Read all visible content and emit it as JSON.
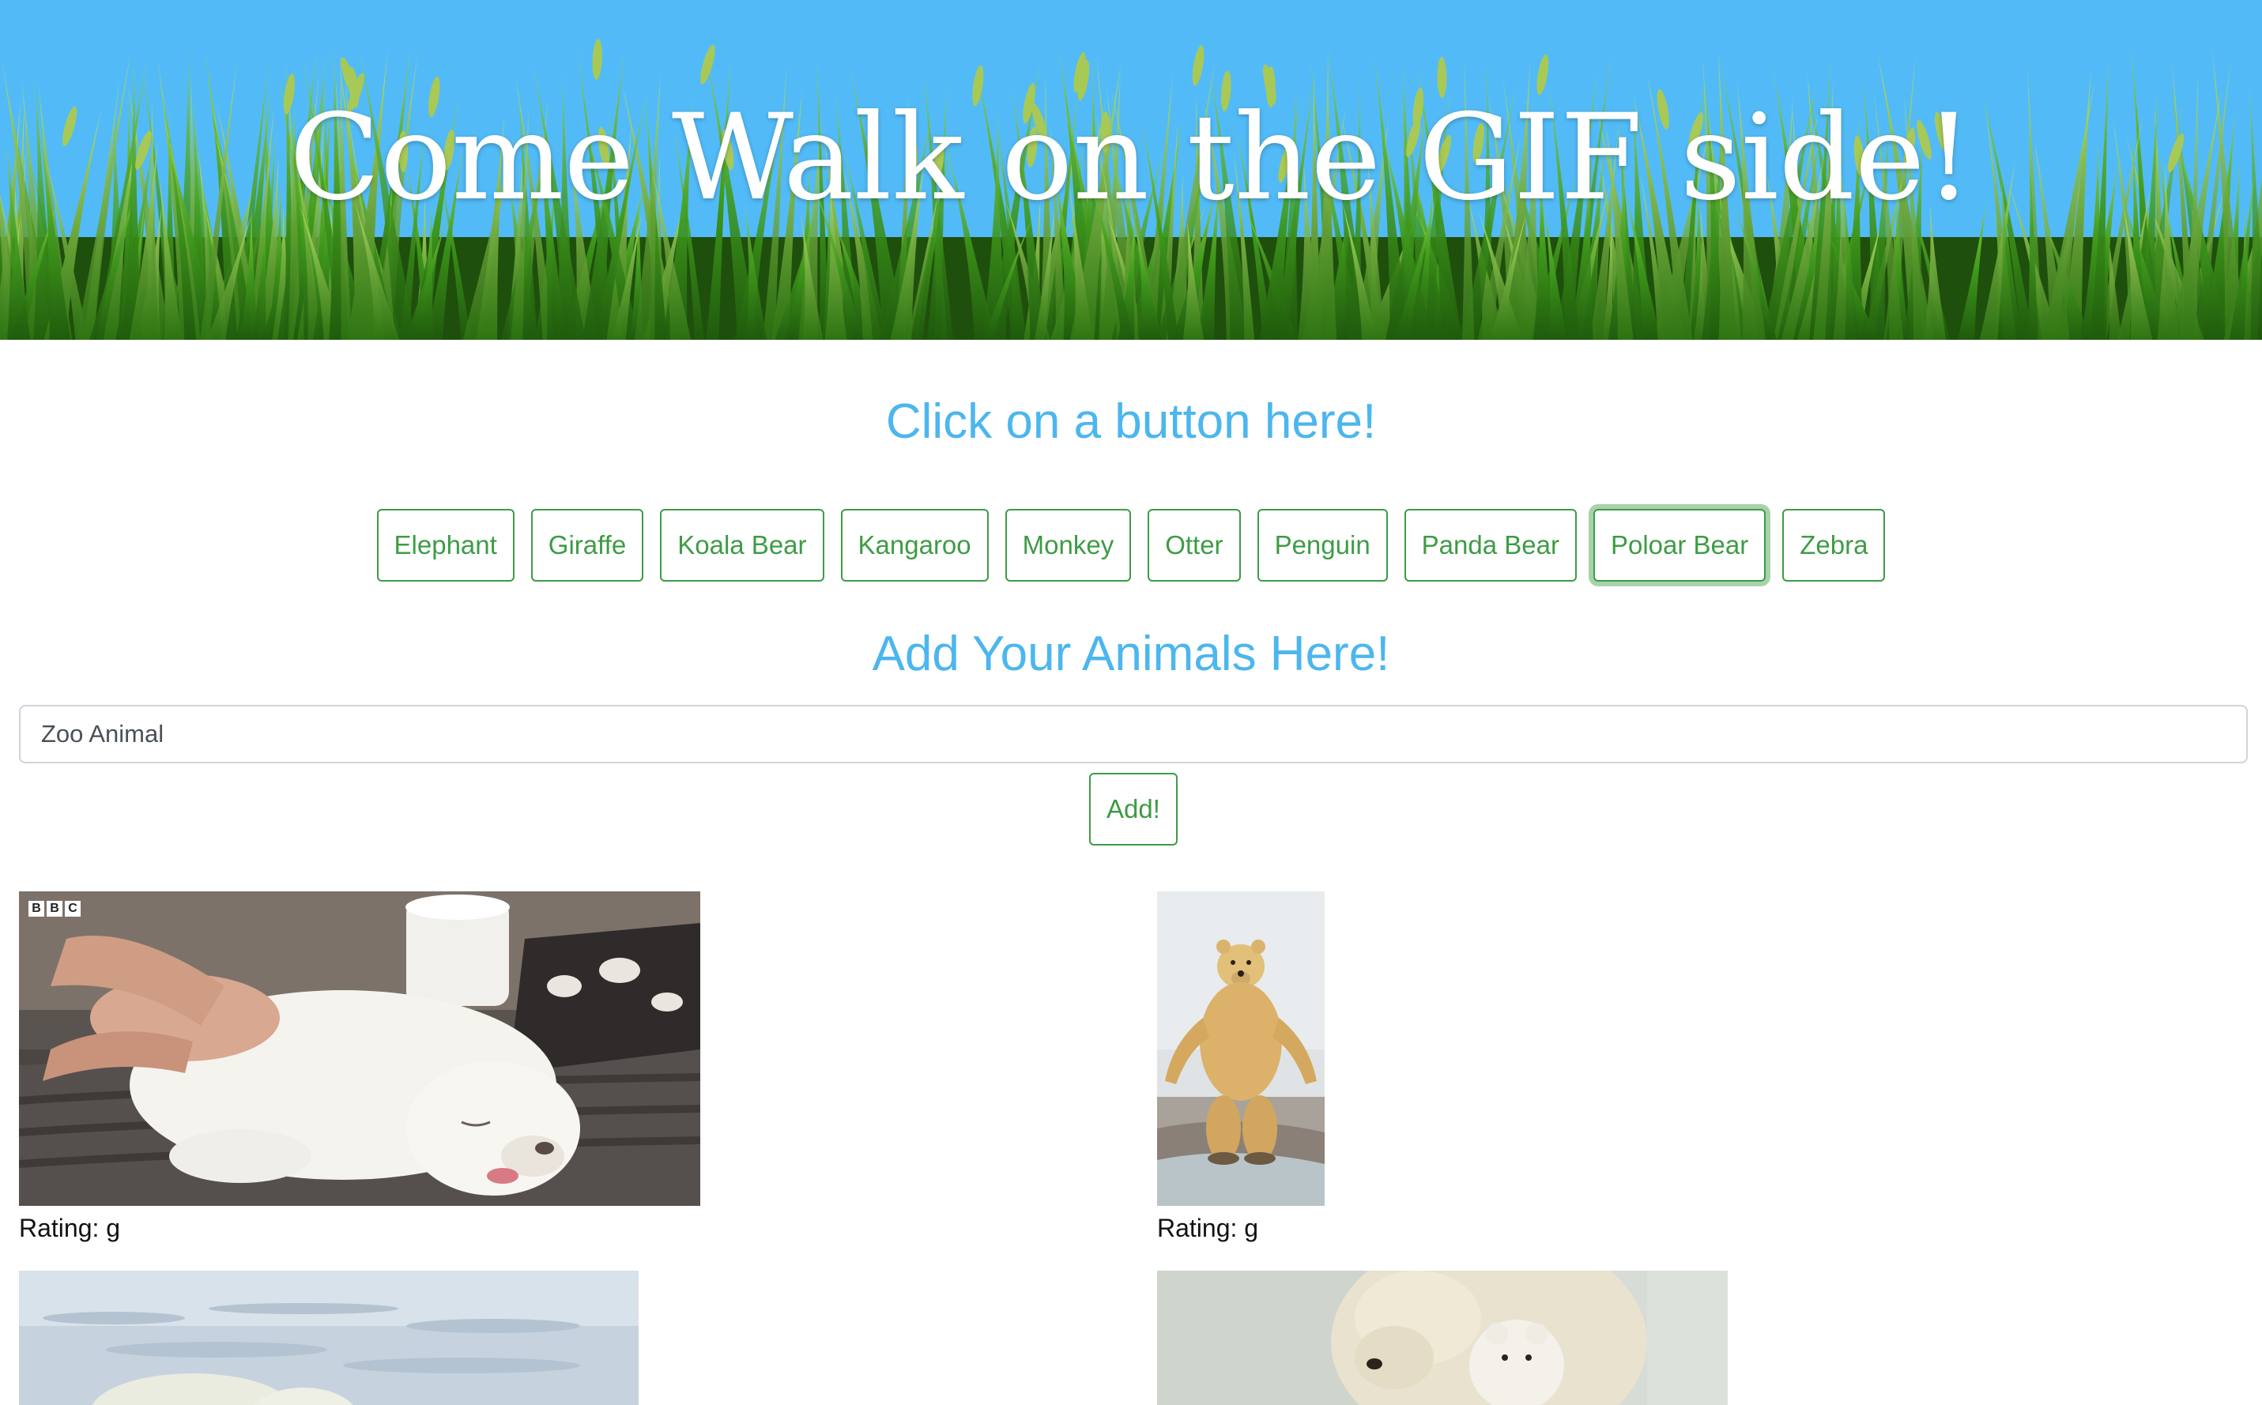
{
  "banner": {
    "title": "Come Walk on the GIF side!",
    "sky_color": "#52bbf7"
  },
  "buttons_section": {
    "heading": "Click on a button here!",
    "buttons": [
      "Elephant",
      "Giraffe",
      "Koala Bear",
      "Kangaroo",
      "Monkey",
      "Otter",
      "Penguin",
      "Panda Bear",
      "Poloar Bear",
      "Zebra"
    ],
    "focused_button": "Poloar Bear"
  },
  "add_section": {
    "heading": "Add Your Animals Here!",
    "input_placeholder": "Zoo Animal",
    "add_label": "Add!"
  },
  "results": [
    {
      "rating": "Rating: g",
      "logo": "BBC"
    },
    {
      "rating": "Rating: g"
    },
    {
      "rating": ""
    },
    {
      "rating": ""
    }
  ],
  "colors": {
    "accent_blue": "#4cb6ee",
    "button_green": "#3d9c45"
  }
}
